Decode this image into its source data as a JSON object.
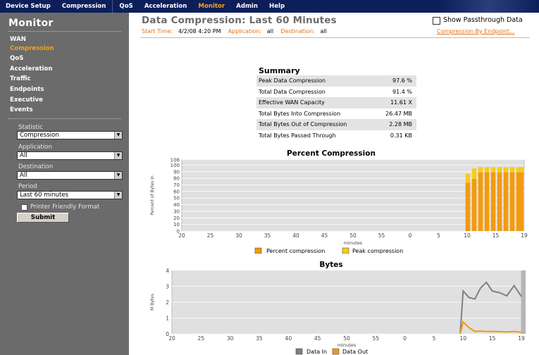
{
  "nav": {
    "items": [
      {
        "label": "Device Setup"
      },
      {
        "label": "Compression"
      },
      {
        "label": "QoS"
      },
      {
        "label": "Acceleration"
      },
      {
        "label": "Monitor"
      },
      {
        "label": "Admin"
      },
      {
        "label": "Help"
      }
    ],
    "active": "Monitor"
  },
  "sidebar": {
    "title": "Monitor",
    "items": [
      {
        "label": "WAN"
      },
      {
        "label": "Compression"
      },
      {
        "label": "QoS"
      },
      {
        "label": "Acceleration"
      },
      {
        "label": "Traffic"
      },
      {
        "label": "Endpoints"
      },
      {
        "label": "Executive"
      },
      {
        "label": "Events"
      }
    ],
    "active": "Compression",
    "form": {
      "statistic_label": "Statistic",
      "statistic_value": "Compression",
      "application_label": "Application",
      "application_value": "All",
      "destination_label": "Destination",
      "destination_value": "All",
      "period_label": "Period",
      "period_value": "Last 60 minutes",
      "printer_label": "Printer Friendly Format",
      "submit_label": "Submit"
    }
  },
  "main": {
    "title": "Data Compression: Last 60 Minutes",
    "passthrough_label": "Show Passthrough Data",
    "start_time_label": "Start Time:",
    "start_time_value": "4/2/08 4:20 PM",
    "application_label": "Application:",
    "application_value": "all",
    "destination_label": "Destination:",
    "destination_value": "all",
    "endpoint_link": "Compression By Endpoint..."
  },
  "summary": {
    "title": "Summary",
    "rows": [
      {
        "label": "Peak Data Compression",
        "value": "97.6 %"
      },
      {
        "label": "Total Data Compression",
        "value": "91.4 %"
      },
      {
        "label": "Effective WAN Capacity",
        "value": "11.61 X"
      },
      {
        "label": "Total Bytes Into Compression",
        "value": "26.47 MB"
      },
      {
        "label": "Total Bytes Out of Compression",
        "value": "2.28 MB"
      },
      {
        "label": "Total Bytes Passed Through",
        "value": "0.31 KB"
      }
    ]
  },
  "colors": {
    "nav_bg": "#0c1f5a",
    "accent": "#f7a21d",
    "sidebar_bg": "#6b6b6b",
    "percent_bar": "#f29a12",
    "peak_bar": "#f8cc1a",
    "data_in": "#808080",
    "data_out": "#f29a12"
  },
  "chart_data": [
    {
      "type": "bar",
      "title": "Percent Compression",
      "xlabel": "minutes",
      "ylabel": "Percent of Bytes In",
      "ylim": [
        0,
        108
      ],
      "yticks": [
        0,
        10,
        20,
        30,
        40,
        50,
        60,
        70,
        80,
        90,
        100,
        108
      ],
      "xtick_labels": [
        "20",
        "25",
        "30",
        "35",
        "40",
        "45",
        "50",
        "55",
        "0",
        "5",
        "10",
        "15",
        "19"
      ],
      "categories": [
        "10",
        "11",
        "12",
        "13",
        "14",
        "15",
        "16",
        "17",
        "18",
        "19"
      ],
      "series": [
        {
          "name": "Percent compression",
          "values": [
            73,
            79,
            89,
            89,
            89,
            89,
            89,
            89,
            89,
            89
          ]
        },
        {
          "name": "Peak compression",
          "values": [
            87,
            95,
            97,
            97,
            97,
            97,
            97,
            97,
            97,
            97
          ]
        }
      ],
      "grid": true,
      "legend": "bottom"
    },
    {
      "type": "line",
      "title": "Bytes",
      "xlabel": "minutes",
      "ylabel": "M Bytes",
      "ylim": [
        0,
        4
      ],
      "yticks": [
        0,
        1,
        2,
        3,
        4
      ],
      "xtick_labels": [
        "20",
        "25",
        "30",
        "35",
        "40",
        "45",
        "50",
        "55",
        "0",
        "5",
        "10",
        "15",
        "19"
      ],
      "x": [
        9.5,
        10,
        11,
        12,
        13,
        14,
        15,
        16,
        17,
        18,
        19
      ],
      "series": [
        {
          "name": "Data In",
          "values": [
            0,
            2.7,
            2.3,
            2.2,
            2.9,
            3.25,
            2.7,
            2.6,
            2.4,
            3.05,
            2.35
          ]
        },
        {
          "name": "Data Out",
          "values": [
            0,
            0.75,
            0.4,
            0.15,
            0.18,
            0.15,
            0.15,
            0.14,
            0.12,
            0.15,
            0.1
          ]
        }
      ],
      "grid": true,
      "legend": "bottom"
    }
  ]
}
